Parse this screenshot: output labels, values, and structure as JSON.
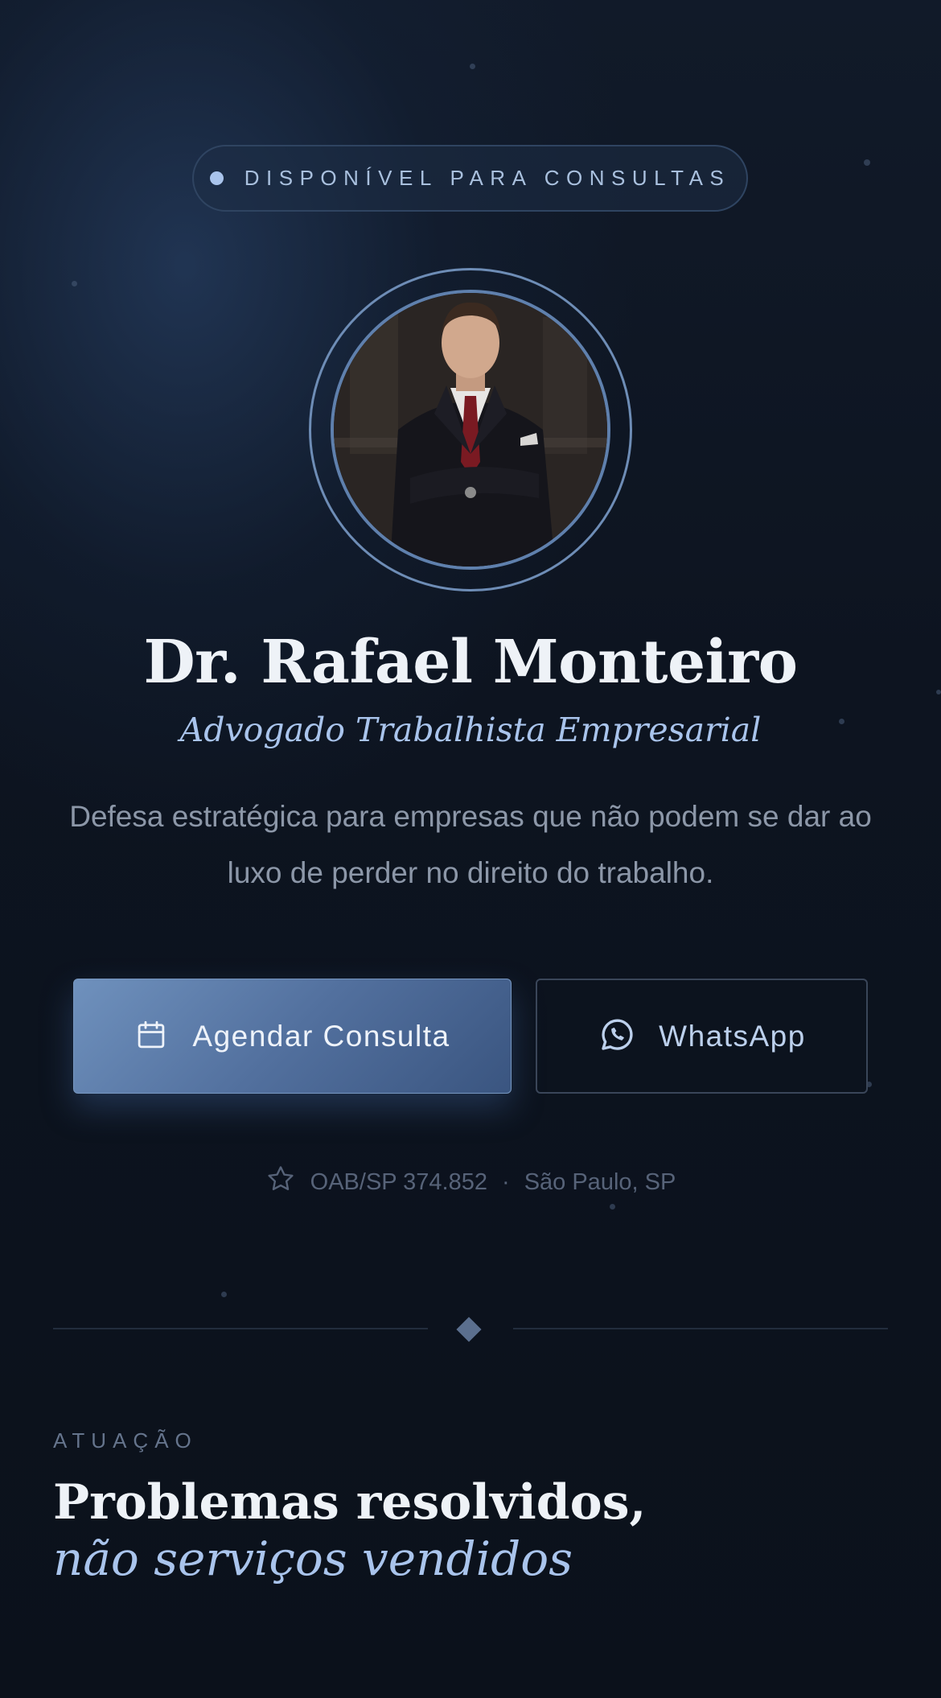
{
  "badge": {
    "text": "DISPONÍVEL PARA CONSULTAS"
  },
  "profile": {
    "name": "Dr. Rafael Monteiro",
    "role": "Advogado Trabalhista Empresarial",
    "description": "Defesa estratégica para empresas que não podem se dar ao luxo de perder no direito do trabalho."
  },
  "actions": {
    "primary_label": "Agendar Consulta",
    "primary_icon": "calendar-icon",
    "secondary_label": "WhatsApp",
    "secondary_icon": "whatsapp-icon"
  },
  "credentials": {
    "icon": "star-icon",
    "oab": "OAB/SP 374.852",
    "separator": "·",
    "location": "São Paulo, SP"
  },
  "section": {
    "eyebrow": "ATUAÇÃO",
    "title_line1": "Problemas resolvidos,",
    "title_line2": "não serviços vendidos"
  },
  "colors": {
    "background": "#0c121c",
    "accent": "#a9c4ec",
    "primary_button": "#52709e"
  }
}
